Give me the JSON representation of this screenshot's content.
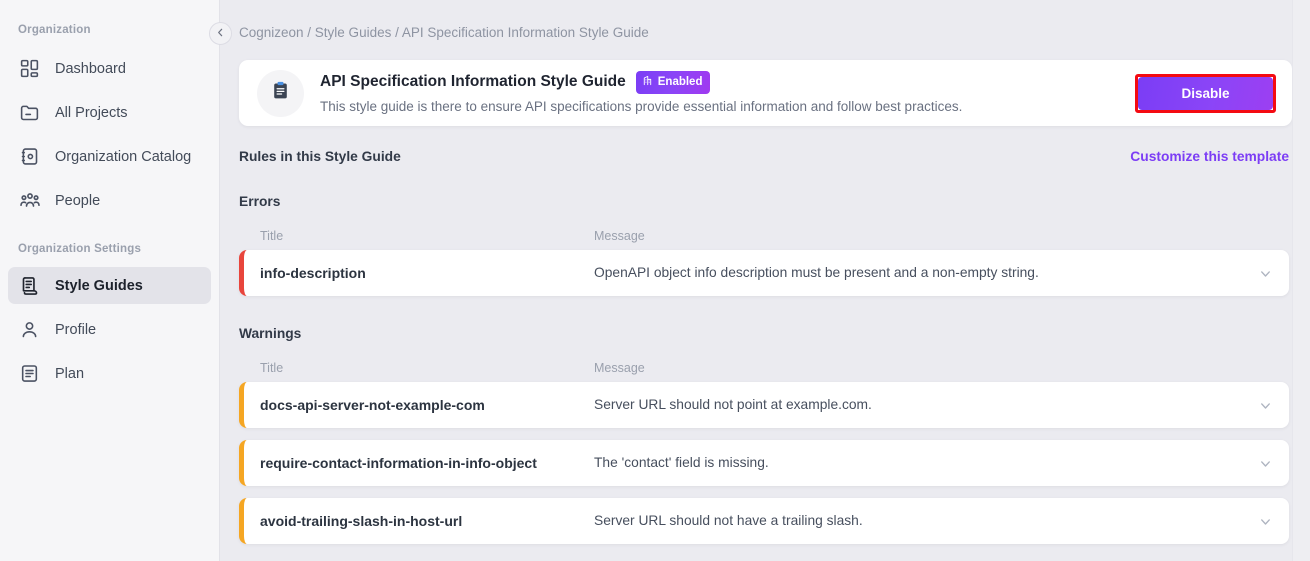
{
  "sidebar": {
    "sections": [
      {
        "title": "Organization",
        "items": [
          {
            "label": "Dashboard",
            "icon": "dashboard-icon"
          },
          {
            "label": "All Projects",
            "icon": "folder-icon"
          },
          {
            "label": "Organization Catalog",
            "icon": "catalog-icon"
          },
          {
            "label": "People",
            "icon": "people-icon"
          }
        ]
      },
      {
        "title": "Organization Settings",
        "items": [
          {
            "label": "Style Guides",
            "icon": "scroll-icon",
            "active": true
          },
          {
            "label": "Profile",
            "icon": "user-icon"
          },
          {
            "label": "Plan",
            "icon": "document-icon"
          }
        ]
      }
    ],
    "collapse_icon": "chevron-left-icon"
  },
  "breadcrumb": {
    "text": "Cognizeon / Style Guides / API Specification Information Style Guide"
  },
  "guide_card": {
    "icon": "clipboard-icon",
    "title": "API Specification Information Style Guide",
    "badge_label": "Enabled",
    "badge_icon": "certificate-icon",
    "description": "This style guide is there to ensure API specifications provide essential information and follow best practices.",
    "action_label": "Disable"
  },
  "rules": {
    "heading": "Rules in this Style Guide",
    "customize_link": "Customize this template",
    "columns": {
      "title": "Title",
      "message": "Message"
    },
    "groups": [
      {
        "name": "Errors",
        "severity": "error",
        "rows": [
          {
            "title": "info-description",
            "message": "OpenAPI object info description must be present and a non-empty string."
          }
        ]
      },
      {
        "name": "Warnings",
        "severity": "warning",
        "rows": [
          {
            "title": "docs-api-server-not-example-com",
            "message": "Server URL should not point at example.com."
          },
          {
            "title": "require-contact-information-in-info-object",
            "message": "The 'contact' field is missing."
          },
          {
            "title": "avoid-trailing-slash-in-host-url",
            "message": "Server URL should not have a trailing slash."
          }
        ]
      }
    ]
  },
  "colors": {
    "accent_purple": "#7c3df5",
    "error_red": "#e8453c",
    "warning_orange": "#f5a623",
    "highlight_red": "#f40b12",
    "page_background": "#ebebf0",
    "sidebar_background": "#f6f6f8"
  }
}
